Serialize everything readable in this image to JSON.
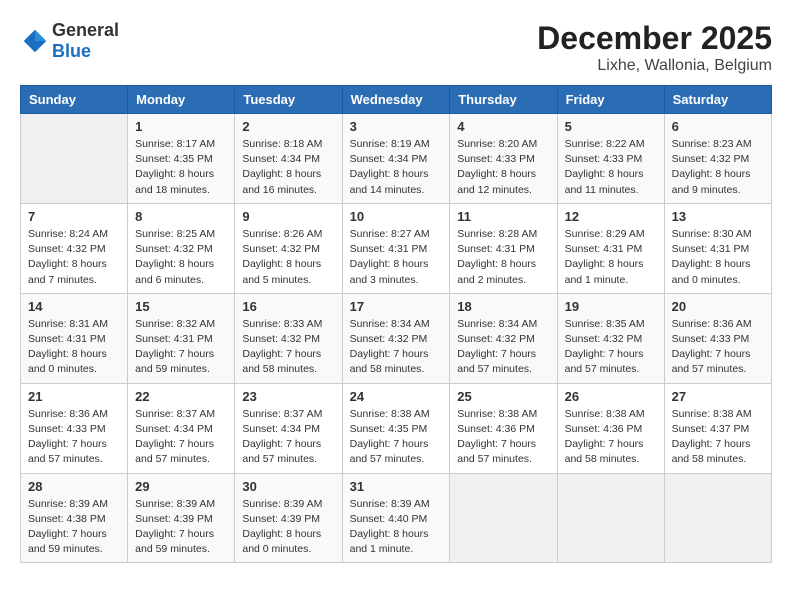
{
  "header": {
    "logo_general": "General",
    "logo_blue": "Blue",
    "title": "December 2025",
    "subtitle": "Lixhe, Wallonia, Belgium"
  },
  "columns": [
    "Sunday",
    "Monday",
    "Tuesday",
    "Wednesday",
    "Thursday",
    "Friday",
    "Saturday"
  ],
  "weeks": [
    [
      {
        "day": "",
        "info": ""
      },
      {
        "day": "1",
        "info": "Sunrise: 8:17 AM\nSunset: 4:35 PM\nDaylight: 8 hours\nand 18 minutes."
      },
      {
        "day": "2",
        "info": "Sunrise: 8:18 AM\nSunset: 4:34 PM\nDaylight: 8 hours\nand 16 minutes."
      },
      {
        "day": "3",
        "info": "Sunrise: 8:19 AM\nSunset: 4:34 PM\nDaylight: 8 hours\nand 14 minutes."
      },
      {
        "day": "4",
        "info": "Sunrise: 8:20 AM\nSunset: 4:33 PM\nDaylight: 8 hours\nand 12 minutes."
      },
      {
        "day": "5",
        "info": "Sunrise: 8:22 AM\nSunset: 4:33 PM\nDaylight: 8 hours\nand 11 minutes."
      },
      {
        "day": "6",
        "info": "Sunrise: 8:23 AM\nSunset: 4:32 PM\nDaylight: 8 hours\nand 9 minutes."
      }
    ],
    [
      {
        "day": "7",
        "info": "Sunrise: 8:24 AM\nSunset: 4:32 PM\nDaylight: 8 hours\nand 7 minutes."
      },
      {
        "day": "8",
        "info": "Sunrise: 8:25 AM\nSunset: 4:32 PM\nDaylight: 8 hours\nand 6 minutes."
      },
      {
        "day": "9",
        "info": "Sunrise: 8:26 AM\nSunset: 4:32 PM\nDaylight: 8 hours\nand 5 minutes."
      },
      {
        "day": "10",
        "info": "Sunrise: 8:27 AM\nSunset: 4:31 PM\nDaylight: 8 hours\nand 3 minutes."
      },
      {
        "day": "11",
        "info": "Sunrise: 8:28 AM\nSunset: 4:31 PM\nDaylight: 8 hours\nand 2 minutes."
      },
      {
        "day": "12",
        "info": "Sunrise: 8:29 AM\nSunset: 4:31 PM\nDaylight: 8 hours\nand 1 minute."
      },
      {
        "day": "13",
        "info": "Sunrise: 8:30 AM\nSunset: 4:31 PM\nDaylight: 8 hours\nand 0 minutes."
      }
    ],
    [
      {
        "day": "14",
        "info": "Sunrise: 8:31 AM\nSunset: 4:31 PM\nDaylight: 8 hours\nand 0 minutes."
      },
      {
        "day": "15",
        "info": "Sunrise: 8:32 AM\nSunset: 4:31 PM\nDaylight: 7 hours\nand 59 minutes."
      },
      {
        "day": "16",
        "info": "Sunrise: 8:33 AM\nSunset: 4:32 PM\nDaylight: 7 hours\nand 58 minutes."
      },
      {
        "day": "17",
        "info": "Sunrise: 8:34 AM\nSunset: 4:32 PM\nDaylight: 7 hours\nand 58 minutes."
      },
      {
        "day": "18",
        "info": "Sunrise: 8:34 AM\nSunset: 4:32 PM\nDaylight: 7 hours\nand 57 minutes."
      },
      {
        "day": "19",
        "info": "Sunrise: 8:35 AM\nSunset: 4:32 PM\nDaylight: 7 hours\nand 57 minutes."
      },
      {
        "day": "20",
        "info": "Sunrise: 8:36 AM\nSunset: 4:33 PM\nDaylight: 7 hours\nand 57 minutes."
      }
    ],
    [
      {
        "day": "21",
        "info": "Sunrise: 8:36 AM\nSunset: 4:33 PM\nDaylight: 7 hours\nand 57 minutes."
      },
      {
        "day": "22",
        "info": "Sunrise: 8:37 AM\nSunset: 4:34 PM\nDaylight: 7 hours\nand 57 minutes."
      },
      {
        "day": "23",
        "info": "Sunrise: 8:37 AM\nSunset: 4:34 PM\nDaylight: 7 hours\nand 57 minutes."
      },
      {
        "day": "24",
        "info": "Sunrise: 8:38 AM\nSunset: 4:35 PM\nDaylight: 7 hours\nand 57 minutes."
      },
      {
        "day": "25",
        "info": "Sunrise: 8:38 AM\nSunset: 4:36 PM\nDaylight: 7 hours\nand 57 minutes."
      },
      {
        "day": "26",
        "info": "Sunrise: 8:38 AM\nSunset: 4:36 PM\nDaylight: 7 hours\nand 58 minutes."
      },
      {
        "day": "27",
        "info": "Sunrise: 8:38 AM\nSunset: 4:37 PM\nDaylight: 7 hours\nand 58 minutes."
      }
    ],
    [
      {
        "day": "28",
        "info": "Sunrise: 8:39 AM\nSunset: 4:38 PM\nDaylight: 7 hours\nand 59 minutes."
      },
      {
        "day": "29",
        "info": "Sunrise: 8:39 AM\nSunset: 4:39 PM\nDaylight: 7 hours\nand 59 minutes."
      },
      {
        "day": "30",
        "info": "Sunrise: 8:39 AM\nSunset: 4:39 PM\nDaylight: 8 hours\nand 0 minutes."
      },
      {
        "day": "31",
        "info": "Sunrise: 8:39 AM\nSunset: 4:40 PM\nDaylight: 8 hours\nand 1 minute."
      },
      {
        "day": "",
        "info": ""
      },
      {
        "day": "",
        "info": ""
      },
      {
        "day": "",
        "info": ""
      }
    ]
  ]
}
